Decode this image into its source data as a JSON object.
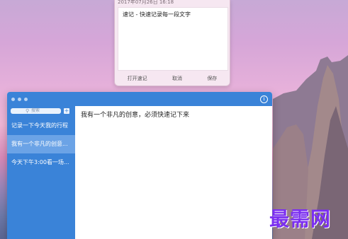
{
  "quick_note": {
    "date": "2017年07月26日 16:18",
    "text": "速记 - 快速记录每一段文字",
    "open_button": "打开速记",
    "cancel_button": "取消",
    "save_button": "保存"
  },
  "main_window": {
    "search_placeholder": "搜索",
    "add_label": "+",
    "info_label": "i",
    "notes": [
      {
        "title": "记录一下今天我的行程"
      },
      {
        "title": "我有一个非凡的创意..."
      },
      {
        "title": "今天下午3:00看一场..."
      }
    ],
    "selected_note_body": "我有一个非凡的创意，必须快速记下来"
  },
  "watermark": "最需网",
  "colors": {
    "accent": "#3a83d8",
    "selected_item": "#6ba3e6",
    "watermark": "#7b2ff0"
  }
}
